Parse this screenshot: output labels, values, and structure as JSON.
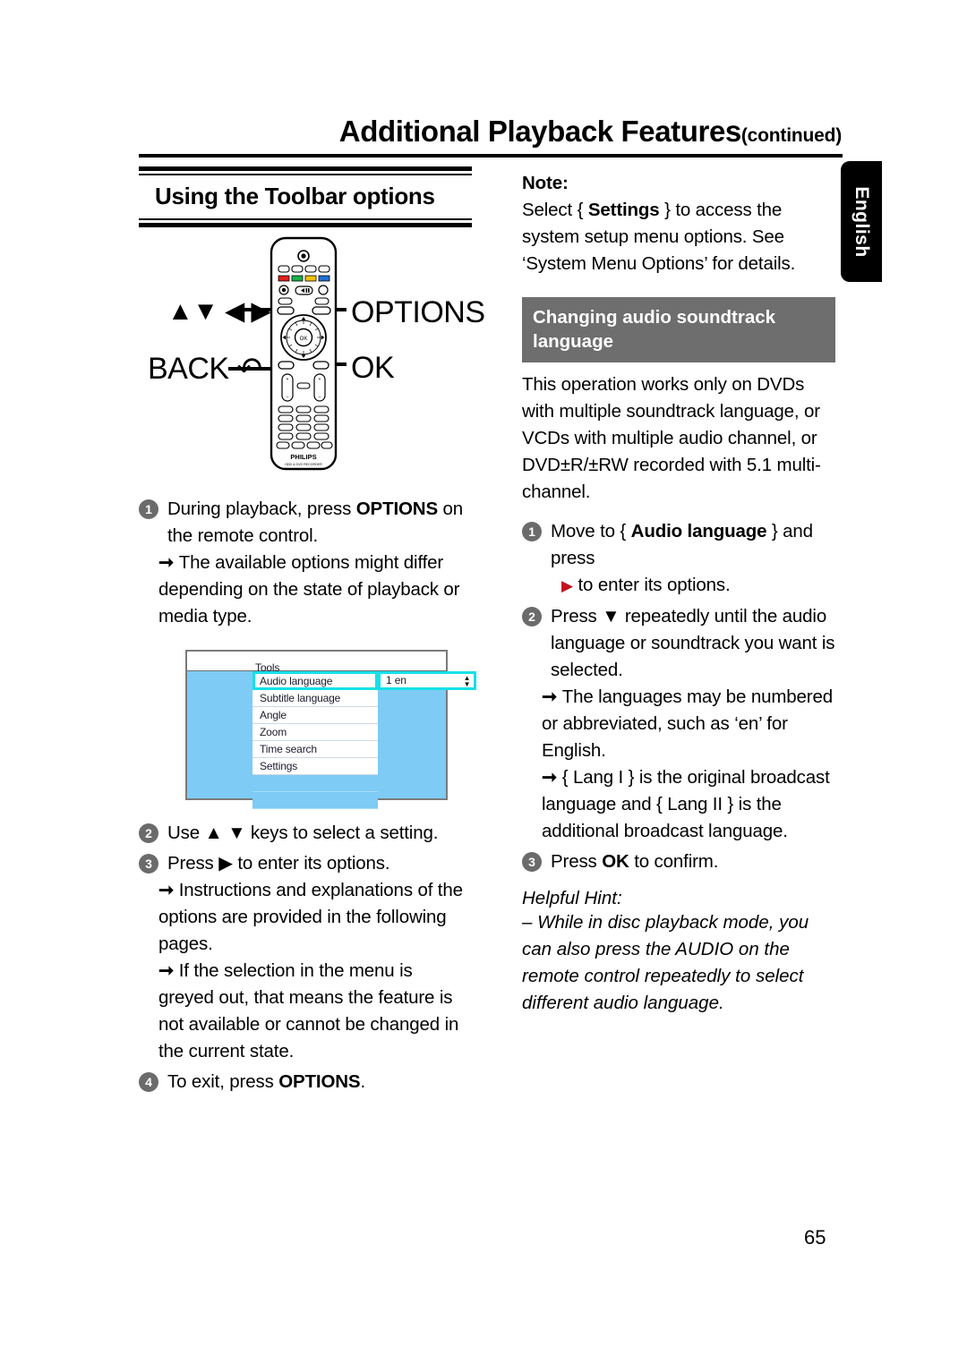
{
  "running_head": {
    "title": "Additional Playback Features",
    "continued": "(continued)"
  },
  "language_tab": {
    "label": "English"
  },
  "page_number": "65",
  "left_column": {
    "section_heading": "Using the Toolbar options",
    "remote_callouts": {
      "arrows": "▲▼ ◀ ▶",
      "back": "BACK ↶",
      "options": "OPTIONS",
      "ok": "OK"
    },
    "steps": [
      {
        "num": "1",
        "lines": [
          "During playback, press OPTIONS on the remote control."
        ],
        "text_before_bold": "During playback, press ",
        "bold": "OPTIONS",
        "text_after_bold": " on the remote control.",
        "subs": [
          "The available options might differ depending on the state of playback or media type."
        ]
      },
      {
        "num": "2",
        "text_plain": "Use ▲ ▼ keys to select a setting.",
        "subs": []
      },
      {
        "num": "3",
        "text_plain": "Press ▶ to enter its options.",
        "subs": [
          "Instructions and explanations of the options are provided in the following pages.",
          "If the selection in the menu is greyed out, that means the feature is not available or cannot be changed in the current state."
        ]
      },
      {
        "num": "4",
        "text_before_bold": "To exit, press ",
        "bold": "OPTIONS",
        "text_after_bold": ".",
        "subs": []
      }
    ],
    "osd_menu": {
      "title": "Tools",
      "items": [
        "Audio language",
        "Subtitle language",
        "Angle",
        "Zoom",
        "Time search",
        "Settings"
      ],
      "selected_item": "Audio language",
      "selected_value": "1 en",
      "spinner_up": "▲",
      "spinner_down": "▼",
      "highlight_color": "#16e0e8",
      "pane_color": "#7ecbf5"
    }
  },
  "right_column": {
    "note_label": "Note:",
    "note_before_bold": "Select { ",
    "note_bold": "Settings",
    "note_after_bold": " } to access the system setup menu options.  See ‘System Menu Options’ for details.",
    "band_heading": "Changing audio soundtrack language",
    "band_color": "#6e6e6e",
    "intro": "This operation works only on DVDs with multiple soundtrack language, or VCDs with multiple audio channel, or DVD±R/±RW recorded with 5.1 multi-channel.",
    "steps": [
      {
        "num": "1",
        "before_bold": "Move to { ",
        "bold": "Audio language",
        "after_bold": " } and press",
        "second_line_arrow": "▶",
        "second_line": " to enter its options.",
        "arrow_color": "#c1121f",
        "subs": []
      },
      {
        "num": "2",
        "text_plain": "Press ▼ repeatedly until the audio language or soundtrack you want is selected.",
        "subs": [
          "The languages may be numbered or abbreviated, such as ‘en’ for English.",
          "{ Lang I } is the original broadcast language and { Lang II } is the additional broadcast language."
        ]
      },
      {
        "num": "3",
        "before_bold": "Press ",
        "bold": "OK",
        "after_bold": " to confirm.",
        "subs": []
      }
    ],
    "hint_title": "Helpful Hint:",
    "hint_body": "– While in disc playback mode, you can also press the AUDIO on the remote control repeatedly to select different audio language."
  },
  "remote": {
    "brand": "PHILIPS",
    "model_line": "HDD & DVD RECORDER",
    "ok_button_label": "OK"
  }
}
